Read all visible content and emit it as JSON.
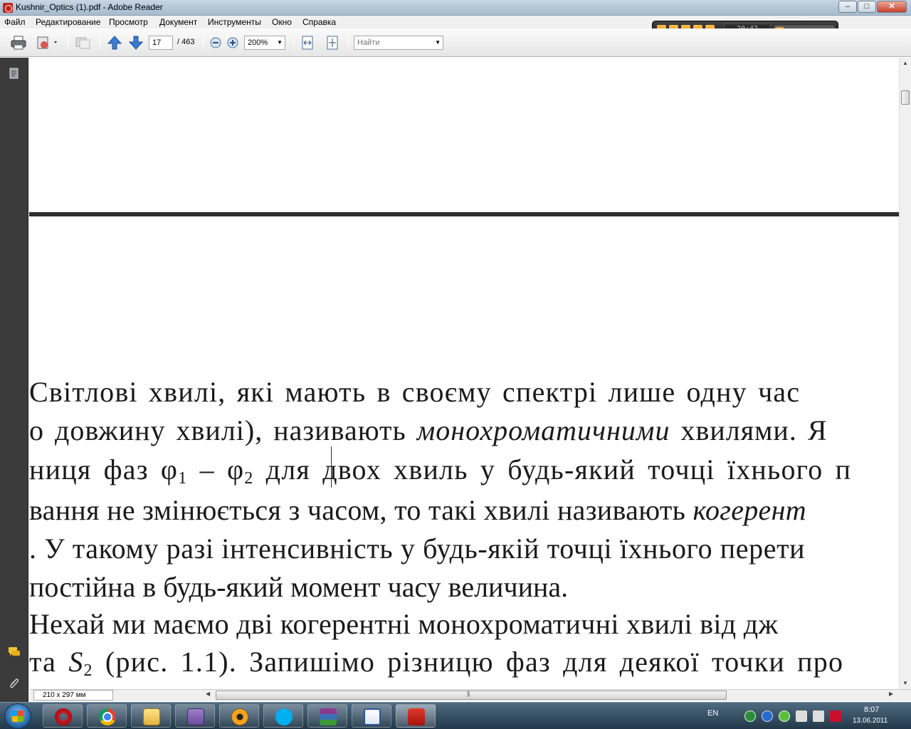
{
  "window": {
    "title": "Kushnir_Optics (1).pdf - Adobe Reader",
    "minimize": "–",
    "maximize": "□",
    "close": "✕"
  },
  "menu": [
    "Файл",
    "Редактирование",
    "Просмотр",
    "Документ",
    "Инструменты",
    "Окно",
    "Справка"
  ],
  "toolbar": {
    "page_current": "17",
    "page_total": "/ 463",
    "zoom": "200%",
    "search_placeholder": "Найти"
  },
  "media_player": {
    "time": "20:42",
    "progress": 0.15
  },
  "document": {
    "lines": [
      {
        "prefix": "",
        "pre": " Світлові хвилі, які мають в своєму спектрі лише одну час",
        "em": "",
        "post": ""
      },
      {
        "prefix": "",
        "pre": "о довжину хвилі), називають ",
        "em": "монохроматичними",
        "post": " хвилями. Я"
      },
      {
        "prefix": "",
        "pre": "ниця фаз  φ",
        "sub1": "1",
        "mid": " – φ",
        "sub2": "2",
        "post": "  для двох хвиль у будь-який точці їхнього п"
      },
      {
        "prefix": "",
        "pre": "вання не змінюється з часом, то такі хвилі називають ",
        "em": "когерент",
        "post": ""
      },
      {
        "prefix": "",
        "pre": ". У такому разі інтенсивність у будь-якій точці їхнього перети",
        "em": "",
        "post": ""
      },
      {
        "prefix": "",
        "pre": "постійна в будь-який момент часу величина.",
        "em": "",
        "post": ""
      },
      {
        "prefix": "",
        "pre": " Нехай ми маємо дві когерентні монохроматичні хвилі від дж",
        "em": "",
        "post": ""
      },
      {
        "prefix": "",
        "pre": "та ",
        "em": "S",
        "sub": "2",
        "post": " (рис. 1.1). Запишімо різницю фаз для деякої точки про"
      }
    ]
  },
  "statusbar": {
    "page_size": "210 x 297 мм"
  },
  "tray": {
    "lang": "EN",
    "time": "8:07",
    "date": "13.06.2011"
  }
}
